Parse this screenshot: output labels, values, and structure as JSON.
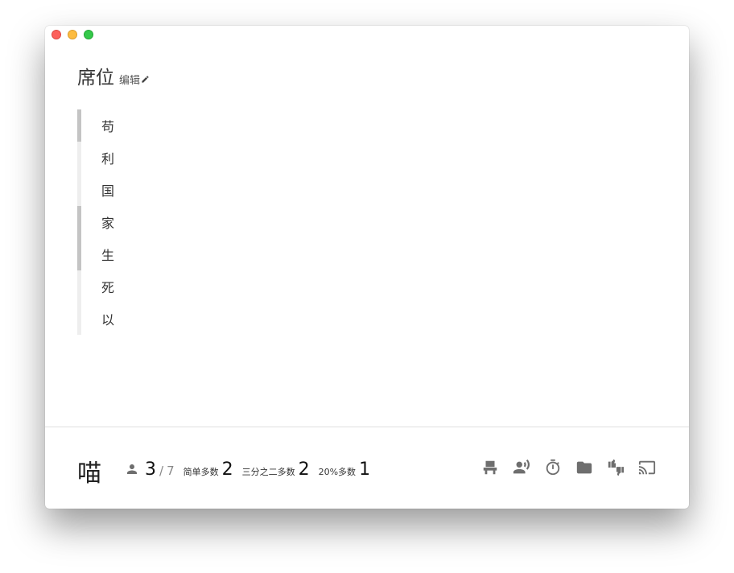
{
  "header": {
    "title": "席位",
    "edit_label": "编辑"
  },
  "seats": [
    {
      "label": "苟",
      "active": true
    },
    {
      "label": "利",
      "active": false
    },
    {
      "label": "国",
      "active": false
    },
    {
      "label": "家",
      "active": true
    },
    {
      "label": "生",
      "active": true
    },
    {
      "label": "死",
      "active": false
    },
    {
      "label": "以",
      "active": false
    }
  ],
  "footer": {
    "name": "喵",
    "present_count": "3",
    "separator": "/",
    "total_count": "7",
    "simple_majority_label": "简单多数",
    "simple_majority_value": "2",
    "two_thirds_label": "三分之二多数",
    "two_thirds_value": "2",
    "twenty_percent_label": "20%多数",
    "twenty_percent_value": "1"
  },
  "toolbar": {
    "icons": [
      "seat-icon",
      "speaker-icon",
      "timer-icon",
      "folder-icon",
      "vote-icon",
      "cast-icon"
    ]
  },
  "colors": {
    "active_seat_bar": "#c4c4c4",
    "inactive_seat_bar": "#eeeeee",
    "icon": "#6e6e6e"
  }
}
